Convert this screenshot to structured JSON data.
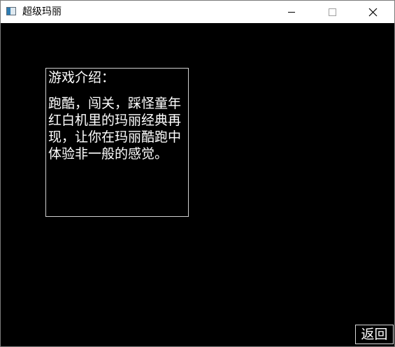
{
  "window": {
    "title": "超级玛丽"
  },
  "intro": {
    "heading": "游戏介绍：",
    "text": "跑酷，闯关，踩怪童年红白机里的玛丽经典再现，让你在玛丽酷跑中体验非一般的感觉。"
  },
  "back_button": {
    "label": "返回"
  },
  "colors": {
    "background": "#000000",
    "text": "#ffffff",
    "titlebar": "#ffffff"
  }
}
